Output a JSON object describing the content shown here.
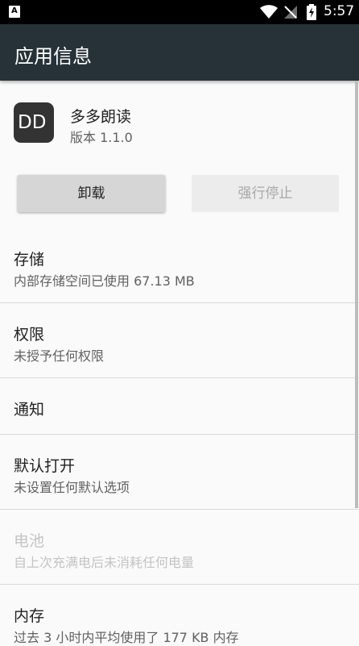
{
  "status_bar": {
    "app_icon_letter": "A",
    "time": "5:57",
    "icons": [
      "wifi-icon",
      "no-signal-icon",
      "battery-charging-icon"
    ]
  },
  "app_bar": {
    "title": "应用信息"
  },
  "app": {
    "icon_text": "DD",
    "name": "多多朗读",
    "version": "版本 1.1.0"
  },
  "buttons": {
    "uninstall": "卸载",
    "force_stop": "强行停止"
  },
  "items": [
    {
      "title": "存储",
      "subtitle": "内部存储空间已使用 67.13 MB",
      "enabled": true
    },
    {
      "title": "权限",
      "subtitle": "未授予任何权限",
      "enabled": true
    },
    {
      "title": "通知",
      "subtitle": "",
      "enabled": true
    },
    {
      "title": "默认打开",
      "subtitle": "未设置任何默认选项",
      "enabled": true
    },
    {
      "title": "电池",
      "subtitle": "自上次充满电后未消耗任何电量",
      "enabled": false
    },
    {
      "title": "内存",
      "subtitle": "过去 3 小时内平均使用了 177 KB 内存",
      "enabled": true
    }
  ],
  "colors": {
    "app_bar": "#263238",
    "status_bar": "#000000",
    "background": "#fafafa"
  }
}
